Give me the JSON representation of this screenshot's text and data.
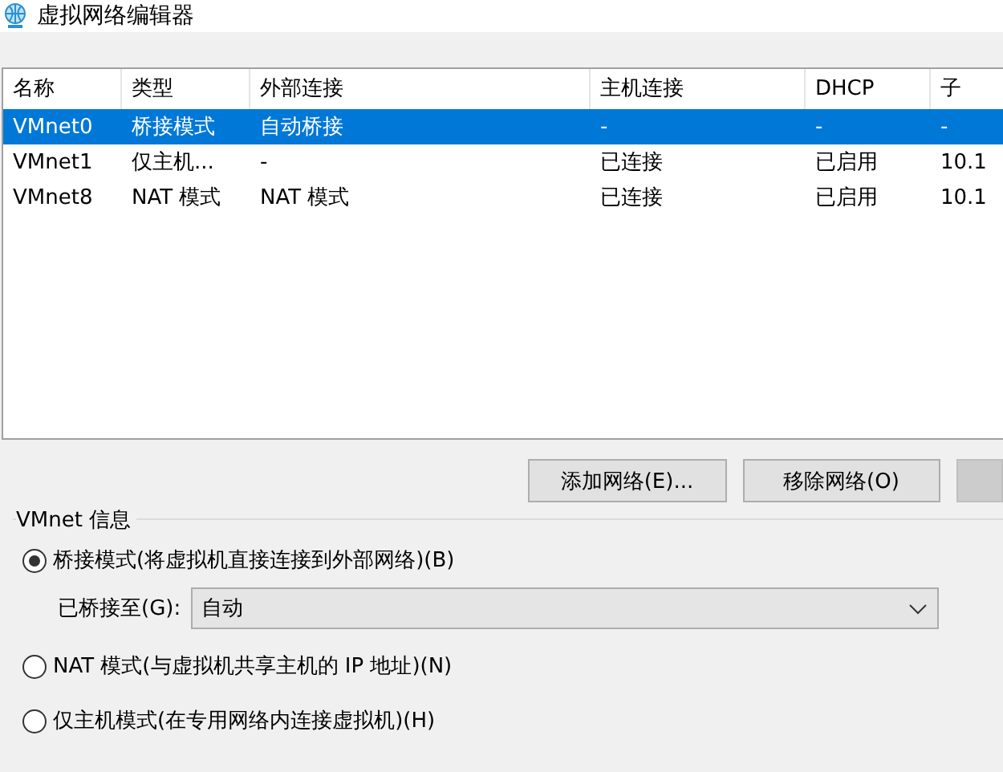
{
  "window": {
    "title": "虚拟网络编辑器"
  },
  "table": {
    "columns": [
      "名称",
      "类型",
      "外部连接",
      "主机连接",
      "DHCP",
      "子"
    ],
    "rows": [
      {
        "cells": [
          "VMnet0",
          "桥接模式",
          "自动桥接",
          "-",
          "-",
          "-"
        ],
        "selected": true
      },
      {
        "cells": [
          "VMnet1",
          "仅主机...",
          "-",
          "已连接",
          "已启用",
          "10.1"
        ],
        "selected": false
      },
      {
        "cells": [
          "VMnet8",
          "NAT 模式",
          "NAT 模式",
          "已连接",
          "已启用",
          "10.1"
        ],
        "selected": false
      }
    ]
  },
  "buttons": [
    "添加网络(E)...",
    "移除网络(O)"
  ],
  "info": {
    "title": "VMnet 信息",
    "modes": [
      {
        "label": "桥接模式(将虚拟机直接连接到外部网络)(B)",
        "selected": true
      },
      {
        "label": "NAT 模式(与虚拟机共享主机的 IP 地址)(N)",
        "selected": false
      },
      {
        "label": "仅主机模式(在专用网络内连接虚拟机)(H)",
        "selected": false
      }
    ],
    "bridge_label": "已桥接至(G):",
    "bridge_value": "自动"
  }
}
